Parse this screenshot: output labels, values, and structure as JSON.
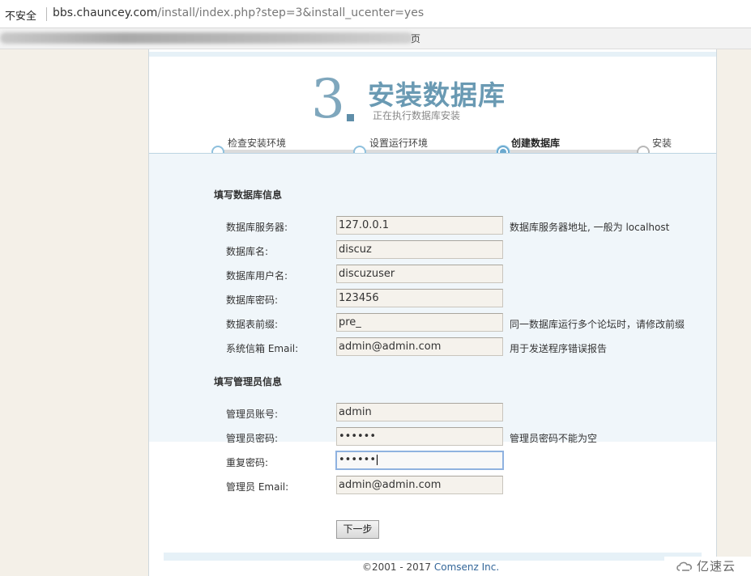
{
  "browser": {
    "security_label": "不安全",
    "url_host": "bbs.chauncey.com",
    "url_path": "/install/index.php?step=3&install_ucenter=yes",
    "bookmarks_trailing_text": "页"
  },
  "header": {
    "step_number": "3",
    "title": "安装数据库",
    "subtitle": "正在执行数据库安装"
  },
  "progress": {
    "steps": [
      {
        "label": "检查安装环境",
        "state": "done"
      },
      {
        "label": "设置运行环境",
        "state": "done"
      },
      {
        "label": "创建数据库",
        "state": "current"
      },
      {
        "label": "安装",
        "state": "pending"
      }
    ]
  },
  "db_section": {
    "title": "填写数据库信息",
    "fields": [
      {
        "label": "数据库服务器:",
        "value": "127.0.0.1",
        "hint": "数据库服务器地址, 一般为 localhost"
      },
      {
        "label": "数据库名:",
        "value": "discuz",
        "hint": ""
      },
      {
        "label": "数据库用户名:",
        "value": "discuzuser",
        "hint": ""
      },
      {
        "label": "数据库密码:",
        "value": "123456",
        "hint": ""
      },
      {
        "label": "数据表前缀:",
        "value": "pre_",
        "hint": "同一数据库运行多个论坛时，请修改前缀"
      },
      {
        "label": "系统信箱 Email:",
        "value": "admin@admin.com",
        "hint": "用于发送程序错误报告"
      }
    ]
  },
  "admin_section": {
    "title": "填写管理员信息",
    "fields": [
      {
        "label": "管理员账号:",
        "value": "admin",
        "hint": ""
      },
      {
        "label": "管理员密码:",
        "value": "••••••",
        "hint": "管理员密码不能为空"
      },
      {
        "label": "重复密码:",
        "value": "••••••",
        "hint": ""
      },
      {
        "label": "管理员 Email:",
        "value": "admin@admin.com",
        "hint": ""
      }
    ]
  },
  "actions": {
    "next_label": "下一步"
  },
  "footer": {
    "copyright": "©2001 - 2017 ",
    "company": "Comsenz Inc."
  },
  "watermark": {
    "text": "亿速云"
  },
  "colors": {
    "title_blue": "#6a9ab3",
    "progress_blue": "#6aa9cf",
    "link_blue": "#336699"
  }
}
